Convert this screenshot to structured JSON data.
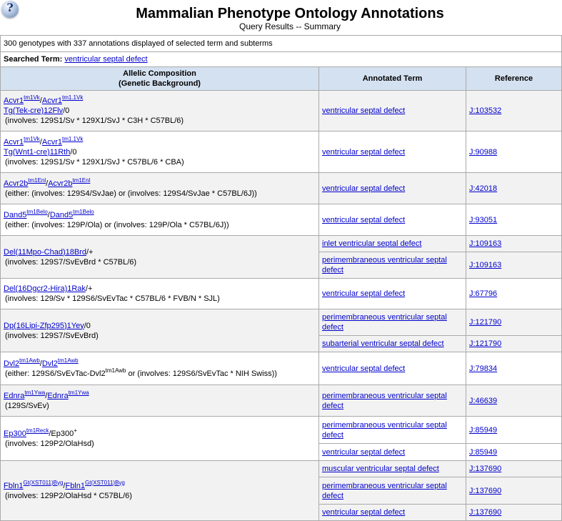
{
  "header": {
    "title": "Mammalian Phenotype Ontology Annotations",
    "subtitle": "Query Results -- Summary",
    "help_icon": "?"
  },
  "summary": "300 genotypes with 337 annotations displayed of selected term and subterms",
  "searched": {
    "label": "Searched Term:",
    "term": "ventricular septal defect"
  },
  "columns": {
    "allelic_line1": "Allelic Composition",
    "allelic_line2": "(Genetic Background)",
    "term": "Annotated Term",
    "reference": "Reference"
  },
  "genotypes": [
    {
      "lines": [
        [
          {
            "t": "Acvr1",
            "l": true
          },
          {
            "t": "tm1Vk",
            "s": true,
            "l": true
          },
          {
            "t": "/"
          },
          {
            "t": "Acvr1",
            "l": true
          },
          {
            "t": "tm1.1Vk",
            "s": true,
            "l": true
          }
        ],
        [
          {
            "t": "Tg(Tek-cre)12Flv",
            "l": true
          },
          {
            "t": "/0"
          }
        ]
      ],
      "background": [
        {
          "t": "(involves: 129S1/Sv * 129X1/SvJ * C3H * C57BL/6)"
        }
      ],
      "annotations": [
        {
          "term": "ventricular septal defect",
          "ref": "J:103532",
          "h": 56
        }
      ]
    },
    {
      "lines": [
        [
          {
            "t": "Acvr1",
            "l": true
          },
          {
            "t": "tm1Vk",
            "s": true,
            "l": true
          },
          {
            "t": "/"
          },
          {
            "t": "Acvr1",
            "l": true
          },
          {
            "t": "tm1.1Vk",
            "s": true,
            "l": true
          }
        ],
        [
          {
            "t": "Tg(Wnt1-cre)11Rth",
            "l": true
          },
          {
            "t": "/0"
          }
        ]
      ],
      "background": [
        {
          "t": "(involves: 129S1/Sv * 129X1/SvJ * C57BL/6 * CBA)"
        }
      ],
      "annotations": [
        {
          "term": "ventricular septal defect",
          "ref": "J:90988",
          "h": 57
        }
      ]
    },
    {
      "lines": [
        [
          {
            "t": "Acvr2b",
            "l": true
          },
          {
            "t": "tm1Enl",
            "s": true,
            "l": true
          },
          {
            "t": "/"
          },
          {
            "t": "Acvr2b",
            "l": true
          },
          {
            "t": "tm1Enl",
            "s": true,
            "l": true
          }
        ]
      ],
      "background": [
        {
          "t": "(either: (involves: 129S4/SvJae) or (involves: 129S4/SvJae * C57BL/6J))"
        }
      ],
      "annotations": [
        {
          "term": "ventricular septal defect",
          "ref": "J:42018",
          "h": 43
        }
      ]
    },
    {
      "lines": [
        [
          {
            "t": "Dand5",
            "l": true
          },
          {
            "t": "tm1Belo",
            "s": true,
            "l": true
          },
          {
            "t": "/"
          },
          {
            "t": "Dand5",
            "l": true
          },
          {
            "t": "tm1Belo",
            "s": true,
            "l": true
          }
        ]
      ],
      "background": [
        {
          "t": "(either: (involves: 129P/Ola) or (involves: 129P/Ola * C57BL/6J))"
        }
      ],
      "annotations": [
        {
          "term": "ventricular septal defect",
          "ref": "J:93051",
          "h": 43
        }
      ]
    },
    {
      "lines": [
        [
          {
            "t": "Del(11Mpo-Chad)18Brd",
            "l": true
          },
          {
            "t": "/+"
          }
        ]
      ],
      "background": [
        {
          "t": "(involves: 129S7/SvEvBrd * C57BL/6)"
        }
      ],
      "annotations": [
        {
          "term": "inlet ventricular septal defect",
          "ref": "J:109163",
          "h": 22
        },
        {
          "term": "perimembraneous ventricular septal defect",
          "ref": "J:109163",
          "h": 36
        }
      ]
    },
    {
      "lines": [
        [
          {
            "t": "Del(16Dgcr2-Hira)1Rak",
            "l": true
          },
          {
            "t": "/+"
          }
        ]
      ],
      "background": [
        {
          "t": "(involves: 129/Sv * 129S6/SvEvTac * C57BL/6 * FVB/N * SJL)"
        }
      ],
      "annotations": [
        {
          "term": "ventricular septal defect",
          "ref": "J:67796",
          "h": 42
        }
      ]
    },
    {
      "lines": [
        [
          {
            "t": "Dp(16Lipi-Zfp295)1Yey",
            "l": true
          },
          {
            "t": "/0"
          }
        ]
      ],
      "background": [
        {
          "t": "(involves: 129S7/SvEvBrd)"
        }
      ],
      "annotations": [
        {
          "term": "perimembraneous ventricular septal defect",
          "ref": "J:121790",
          "h": 36
        },
        {
          "term": "subarterial ventricular septal defect",
          "ref": "J:121790",
          "h": 22
        }
      ]
    },
    {
      "lines": [
        [
          {
            "t": "Dvl2",
            "l": true
          },
          {
            "t": "tm1Awb",
            "s": true,
            "l": true
          },
          {
            "t": "/"
          },
          {
            "t": "Dvl2",
            "l": true
          },
          {
            "t": "tm1Awb",
            "s": true,
            "l": true
          }
        ]
      ],
      "background": [
        {
          "t": "(either: 129S6/SvEvTac-Dvl2"
        },
        {
          "t": "tm1Awb",
          "s": true
        },
        {
          "t": " or (involves: 129S6/SvEvTac * NIH Swiss))"
        }
      ],
      "annotations": [
        {
          "term": "ventricular septal defect",
          "ref": "J:79834",
          "h": 45
        }
      ]
    },
    {
      "lines": [
        [
          {
            "t": "Ednra",
            "l": true
          },
          {
            "t": "tm1Ywa",
            "s": true,
            "l": true
          },
          {
            "t": "/"
          },
          {
            "t": "Ednra",
            "l": true
          },
          {
            "t": "tm1Ywa",
            "s": true,
            "l": true
          }
        ]
      ],
      "background": [
        {
          "t": "(129S/SvEv)"
        }
      ],
      "annotations": [
        {
          "term": "perimembraneous ventricular septal defect",
          "ref": "J:46639",
          "h": 43
        }
      ]
    },
    {
      "lines": [
        [
          {
            "t": "Ep300",
            "l": true
          },
          {
            "t": "tm1Reck",
            "s": true,
            "l": true
          },
          {
            "t": "/Ep300"
          },
          {
            "t": "+",
            "s": true
          }
        ]
      ],
      "background": [
        {
          "t": "(involves: 129P2/OlaHsd)"
        }
      ],
      "annotations": [
        {
          "term": "perimembraneous ventricular septal defect",
          "ref": "J:85949",
          "h": 37
        },
        {
          "term": "ventricular septal defect",
          "ref": "J:85949",
          "h": 23
        }
      ]
    },
    {
      "lines": [
        [
          {
            "t": "Fbln1",
            "l": true
          },
          {
            "t": "Gt(XST011)Byg",
            "s": true,
            "l": true
          },
          {
            "t": "/"
          },
          {
            "t": "Fbln1",
            "l": true
          },
          {
            "t": "Gt(XST011)Byg",
            "s": true,
            "l": true
          }
        ]
      ],
      "background": [
        {
          "t": "(involves: 129P2/OlaHsd * C57BL/6)"
        }
      ],
      "annotations": [
        {
          "term": "muscular ventricular septal defect",
          "ref": "J:137690",
          "h": 22
        },
        {
          "term": "perimembraneous ventricular septal defect",
          "ref": "J:137690",
          "h": 37
        },
        {
          "term": "ventricular septal defect",
          "ref": "J:137690",
          "h": 22
        }
      ]
    }
  ]
}
